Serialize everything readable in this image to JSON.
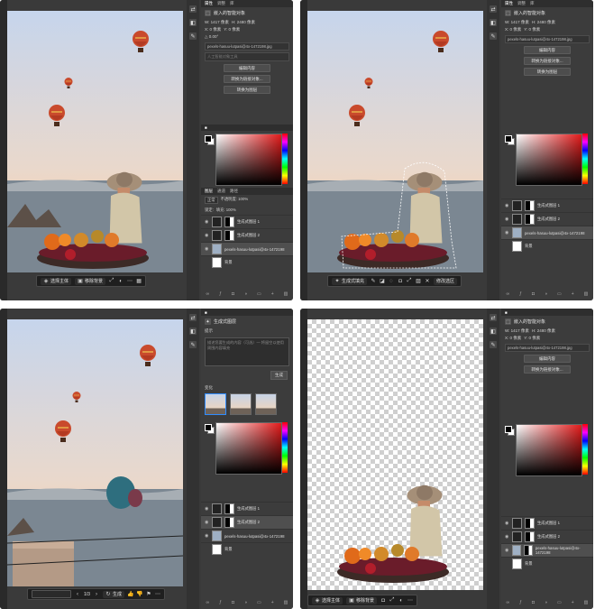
{
  "q1": {
    "ctx": {
      "select_subject": "选择主体",
      "remove_bg": "移除背景"
    },
    "panel": {
      "tabs": [
        "属性",
        "调整",
        "库"
      ],
      "title": "嵌入的智能对象",
      "w": "W: 1417 像素",
      "h": "H: 2480 像素",
      "x": "X: 0 像素",
      "y": "Y: 0 像素",
      "angle": "△ 0.00°",
      "file": "pexels-hasuu-lutpasi@4x-1472198.jpg",
      "placeholder": "人工智能对象工具",
      "btn1": "编辑内容",
      "btn2": "转换为链接对象...",
      "btn3": "转换为图层",
      "layer_tabs": [
        "图层",
        "通道",
        "路径"
      ],
      "blend": "正常",
      "opacity": "不透明度: 100%",
      "lock": "锁定:",
      "fill": "填充: 100%",
      "layers": [
        "生成式图层 1",
        "生成式图层 2",
        "pexels-hasuu-lutpasi@4x-1472198",
        "背景"
      ]
    }
  },
  "q2": {
    "ctx": {
      "gen_fill": "生成式填充",
      "mod_select": "修改选区"
    },
    "panel": {
      "tabs": [
        "属性",
        "调整",
        "库"
      ],
      "title": "嵌入的智能对象",
      "w": "W: 1417 像素",
      "h": "H: 2480 像素",
      "x": "X: 0 像素",
      "y": "Y: 0 像素",
      "file": "pexels-hasuu-lutpasi@4x-1472198.jpg",
      "btn1": "编辑内容",
      "btn2": "转换为链接对象...",
      "btn3": "转换为图层",
      "layers": [
        "生成式图层 1",
        "生成式图层 2",
        "pexels-hasuu-lutpasi@4x-1472198",
        "背景"
      ]
    }
  },
  "q3": {
    "ctx": {
      "generate": "生成",
      "count": "1/3"
    },
    "panel": {
      "title": "生成式图层",
      "prompt_label": "提示",
      "prompt_placeholder": "描述您要生成的内容（可选）— 将留空以使用周围内容填充",
      "gen_btn": "生成",
      "variations": "变化",
      "layers": [
        "生成式图层 1",
        "生成式图层 2",
        "pexels-hasuu-lutpasi@4x-1472198",
        "背景"
      ]
    }
  },
  "q4": {
    "ctx": {
      "select_subject": "选择主体",
      "remove_bg": "移除背景"
    },
    "panel": {
      "title": "嵌入的智能对象",
      "w": "W: 1417 像素",
      "h": "H: 2480 像素",
      "x": "X: 0 像素",
      "y": "Y: 0 像素",
      "file": "pexels-hasuu-lutpasi@4x-1472198.jpg",
      "btn1": "编辑内容",
      "btn2": "转换为链接对象...",
      "layers": [
        "生成式图层 1",
        "生成式图层 2",
        "pexels-hasuu-lutpasi@4x-1472198",
        "背景"
      ]
    }
  },
  "colors": {
    "panel": "#3c3c3c",
    "accent": "#2f8cff",
    "sky_top": "#c9d7ec",
    "sky_bottom": "#f2d6c0"
  }
}
